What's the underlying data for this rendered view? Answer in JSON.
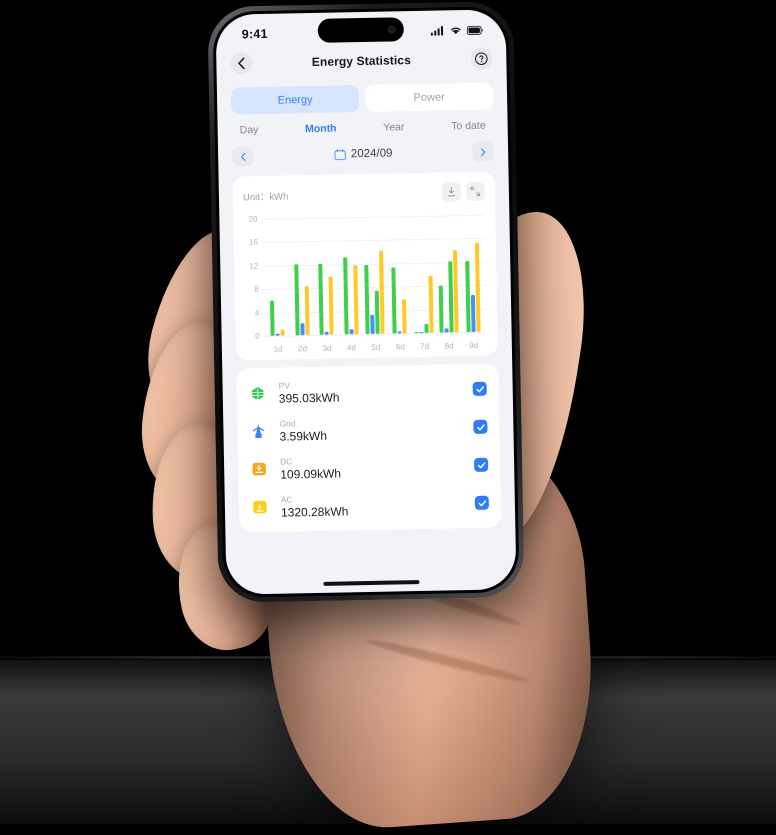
{
  "status_bar": {
    "time": "9:41",
    "signal_icon": "cellular-signal-icon",
    "wifi_icon": "wifi-icon",
    "battery_icon": "battery-icon"
  },
  "nav": {
    "back_icon": "chevron-left-icon",
    "title": "Energy Statistics",
    "help_icon": "question-mark-circle-icon"
  },
  "segmented": {
    "tabs": [
      {
        "label": "Energy",
        "active": true
      },
      {
        "label": "Power",
        "active": false
      }
    ]
  },
  "periods": [
    {
      "label": "Day",
      "active": false
    },
    {
      "label": "Month",
      "active": true
    },
    {
      "label": "Year",
      "active": false
    },
    {
      "label": "To date",
      "active": false
    }
  ],
  "date_selector": {
    "prev_icon": "chevron-left-icon",
    "calendar_icon": "calendar-icon",
    "value": "2024/09",
    "next_icon": "chevron-right-icon"
  },
  "chart_card": {
    "unit_label": "Unit：kWh",
    "download_icon": "download-icon",
    "fullscreen_icon": "expand-fullscreen-icon"
  },
  "legend": {
    "items": [
      {
        "name": "PV",
        "value": "395.03kWh",
        "icon": "solar-panel-icon",
        "color": "#3ecf4c",
        "checked": true
      },
      {
        "name": "Grid",
        "value": "3.59kWh",
        "icon": "grid-tower-icon",
        "color": "#3b7ff0",
        "checked": true
      },
      {
        "name": "DC",
        "value": "109.09kWh",
        "icon": "dc-inverter-icon",
        "color": "#f5a623",
        "checked": true
      },
      {
        "name": "AC",
        "value": "1320.28kWh",
        "icon": "ac-inverter-icon",
        "color": "#fdd016",
        "checked": true
      }
    ],
    "check_icon": "checkmark-icon"
  },
  "colors": {
    "accent": "#2f7df6",
    "pv": "#3ecf4c",
    "grid": "#4a90f0",
    "ac": "#ffc928",
    "screen_bg": "#f2f3f7"
  },
  "chart_data": {
    "type": "bar",
    "title": "",
    "xlabel": "",
    "ylabel": "kWh",
    "unit": "kWh",
    "ylim": [
      0,
      20
    ],
    "yticks": [
      0,
      4,
      8,
      12,
      16,
      20
    ],
    "grid": true,
    "legend_position": "below-chart",
    "categories": [
      "1d",
      "2d",
      "3d",
      "4d",
      "5d",
      "6d",
      "7d",
      "8d",
      "9d"
    ],
    "series": [
      {
        "name": "PV",
        "color": "#3ecf4c",
        "values": [
          6.0,
          12.1,
          12.1,
          13.1,
          11.8,
          11.3,
          0.1,
          8.0,
          12.2
        ]
      },
      {
        "name": "Grid",
        "color": "#4a90f0",
        "values": [
          0.3,
          2.0,
          0.6,
          0.8,
          3.2,
          0.4,
          0.1,
          0.7,
          6.4
        ]
      },
      {
        "name": "AC",
        "color": "#ffc928",
        "values": [
          1.0,
          8.4,
          10.0,
          11.8,
          14.2,
          5.9,
          9.8,
          14.1,
          15.2
        ]
      }
    ],
    "extra_bars": [
      {
        "name": "PV-b",
        "color": "#3ecf4c",
        "values": [
          null,
          null,
          null,
          null,
          7.4,
          null,
          1.5,
          12.2,
          null
        ]
      }
    ]
  }
}
